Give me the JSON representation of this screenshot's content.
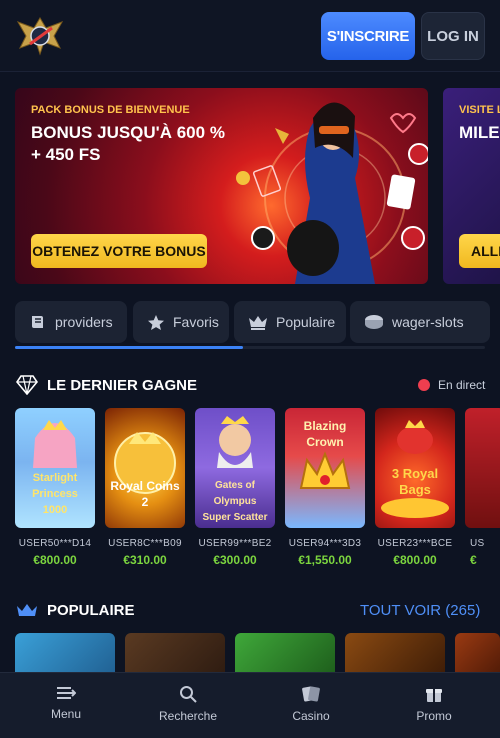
{
  "header": {
    "signup_label": "S'INSCRIRE",
    "login_label": "LOG IN"
  },
  "banners": [
    {
      "kicker": "PACK BONUS DE BIENVENUE",
      "title": "BONUS JUSQU'À 600 % + 450 FS",
      "cta": "OBTENEZ VOTRE BONUS"
    },
    {
      "kicker": "VISITE LA",
      "title": "MILES RÉCO",
      "cta": "ALLE"
    }
  ],
  "tabs": [
    {
      "label": "providers",
      "icon": "book-icon"
    },
    {
      "label": "Favoris",
      "icon": "star-icon"
    },
    {
      "label": "Populaire",
      "icon": "crown-icon"
    },
    {
      "label": "wager-slots",
      "icon": "chip-icon"
    }
  ],
  "winners_section": {
    "title": "LE DERNIER GAGNE",
    "live_label": "En direct",
    "items": [
      {
        "game": "Starlight Princess 1000",
        "user": "USER50***D14",
        "amount": "€800.00"
      },
      {
        "game": "Royal Coins 2",
        "user": "USER8C***B09",
        "amount": "€310.00"
      },
      {
        "game": "Gates of Olympus Super Scatter",
        "user": "USER99***BE2",
        "amount": "€300.00"
      },
      {
        "game": "Blazing Crown",
        "user": "USER94***3D3",
        "amount": "€1,550.00"
      },
      {
        "game": "3 Royal Bags",
        "user": "USER23***BCE",
        "amount": "€800.00"
      },
      {
        "game": "",
        "user": "US",
        "amount": "€"
      }
    ]
  },
  "popular_section": {
    "title": "POPULAIRE",
    "see_all": "TOUT VOIR (265)"
  },
  "bottom_nav": [
    {
      "label": "Menu",
      "icon": "menu-icon"
    },
    {
      "label": "Recherche",
      "icon": "search-icon"
    },
    {
      "label": "Casino",
      "icon": "cards-icon"
    },
    {
      "label": "Promo",
      "icon": "gift-icon"
    }
  ],
  "colors": {
    "background": "#0d1322",
    "accent_blue": "#2563eb",
    "cta_yellow": "#f0b81f",
    "amount_green": "#7cd63f",
    "live_red": "#ef3e4f"
  }
}
